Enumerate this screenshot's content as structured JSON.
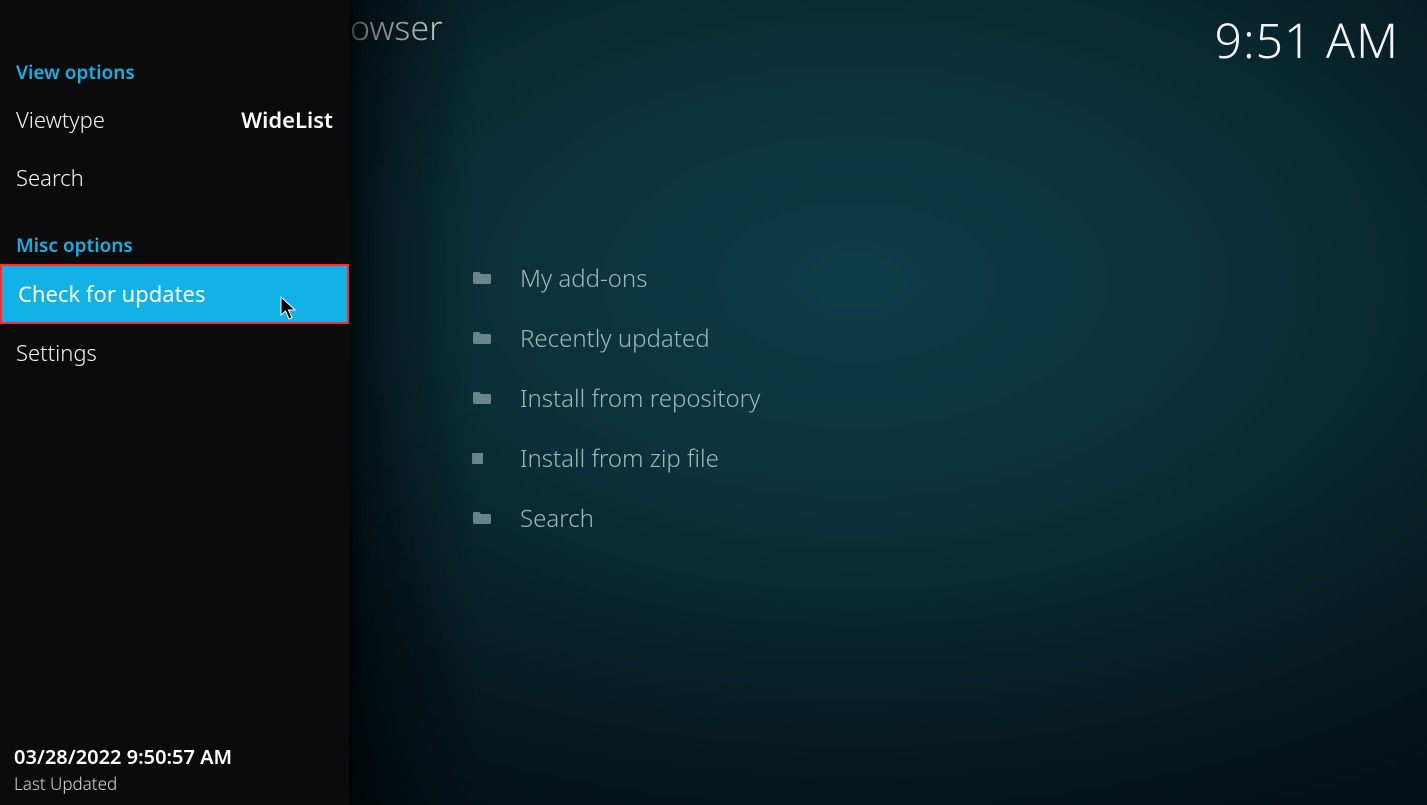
{
  "header": {
    "page_title_suffix": "owser",
    "clock": "9:51 AM"
  },
  "sidebar": {
    "view_options_header": "View options",
    "viewtype_label": "Viewtype",
    "viewtype_value": "WideList",
    "search_label": "Search",
    "misc_options_header": "Misc options",
    "check_updates_label": "Check for updates",
    "settings_label": "Settings",
    "footer_timestamp": "03/28/2022 9:50:57 AM",
    "footer_label": "Last Updated"
  },
  "main": {
    "items": [
      {
        "icon": "folder-icon",
        "label": "My add-ons"
      },
      {
        "icon": "folder-icon",
        "label": "Recently updated"
      },
      {
        "icon": "folder-icon",
        "label": "Install from repository"
      },
      {
        "icon": "zip-icon",
        "label": "Install from zip file"
      },
      {
        "icon": "folder-icon",
        "label": "Search"
      }
    ]
  }
}
